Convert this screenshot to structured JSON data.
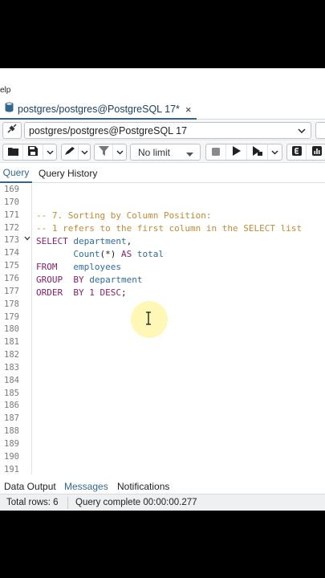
{
  "menu": {
    "help_partial": "elp"
  },
  "tab": {
    "icon": "database-icon",
    "title": "postgres/postgres@PostgreSQL 17*",
    "close": "×"
  },
  "connection": {
    "icon": "plug-icon",
    "value": "postgres/postgres@PostgreSQL 17"
  },
  "toolbar": {
    "buttons": [
      "open-file",
      "save",
      "save-dropdown",
      "edit",
      "edit-dropdown",
      "filter",
      "filter-dropdown",
      "stop",
      "execute",
      "execute-explain",
      "execute-dropdown",
      "explain",
      "explain-analyze"
    ],
    "limit": "No limit"
  },
  "subtabs": {
    "query": "Query",
    "history": "Query History"
  },
  "editor": {
    "line_numbers": [
      "169",
      "170",
      "171",
      "172",
      "173",
      "174",
      "175",
      "176",
      "177",
      "178",
      "179",
      "180",
      "181",
      "182",
      "183",
      "184",
      "185",
      "186",
      "187",
      "188",
      "189",
      "190",
      "191"
    ],
    "comment1": "-- 7. Sorting by Column Position:",
    "comment2": "-- 1 refers to the first column in the SELECT list",
    "line173": {
      "kw": "SELECT",
      "ident": "department",
      "punct": ","
    },
    "line174": {
      "func": "Count",
      "args": "(*)",
      "kw": "AS",
      "ident": "total"
    },
    "line175": {
      "kw": "FROM",
      "ident": "employees"
    },
    "line176": {
      "kw1": "GROUP",
      "kw2": "BY",
      "ident": "department"
    },
    "line177": {
      "kw1": "ORDER",
      "kw2": "BY",
      "num": "1",
      "kw3": "DESC",
      "punct": ";"
    }
  },
  "results": {
    "tabs": [
      "Data Output",
      "Messages",
      "Notifications"
    ],
    "active": "Messages"
  },
  "status": {
    "rows": "Total rows: 6",
    "time": "Query complete 00:00:00.277"
  },
  "colors": {
    "accent": "#326690",
    "keyword": "#8b1f6b",
    "identifier": "#2f6aa3",
    "comment": "#c28a35"
  }
}
